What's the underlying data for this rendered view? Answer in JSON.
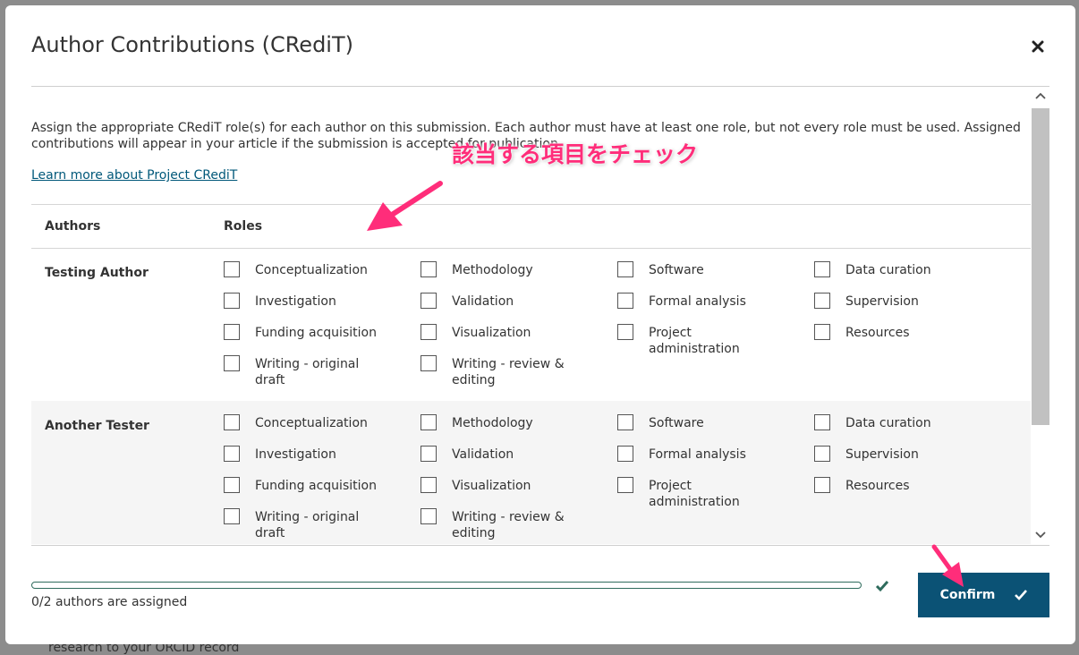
{
  "backdrop": {
    "fragment_text": "research to your ORCID record"
  },
  "modal": {
    "title": "Author Contributions (CRediT)",
    "intro": "Assign the appropriate CRediT role(s) for each author on this submission. Each author must have at least one role, but not every role must be used. Assigned contributions will appear in your article if the submission is accepted for publication.",
    "learn_more_link": "Learn more about Project CRediT",
    "table": {
      "col_authors": "Authors",
      "col_roles": "Roles",
      "authors": [
        {
          "name": "Testing Author",
          "roles": [
            "Conceptualization",
            "Methodology",
            "Software",
            "Data curation",
            "Investigation",
            "Validation",
            "Formal analysis",
            "Supervision",
            "Funding acquisition",
            "Visualization",
            "Project administration",
            "Resources",
            "Writing - original draft",
            "Writing - review & editing"
          ]
        },
        {
          "name": "Another Tester",
          "roles": [
            "Conceptualization",
            "Methodology",
            "Software",
            "Data curation",
            "Investigation",
            "Validation",
            "Formal analysis",
            "Supervision",
            "Funding acquisition",
            "Visualization",
            "Project administration",
            "Resources",
            "Writing - original draft",
            "Writing - review & editing"
          ]
        }
      ]
    },
    "footer": {
      "progress_text": "0/2 authors are assigned",
      "progress_fraction": 0,
      "confirm_label": "Confirm"
    }
  },
  "annotation": {
    "text": "該当する項目をチェック"
  },
  "colors": {
    "accent": "#0b5275",
    "link": "#00587a",
    "progress": "#2e6b5c",
    "annotation": "#ff2d7a"
  }
}
